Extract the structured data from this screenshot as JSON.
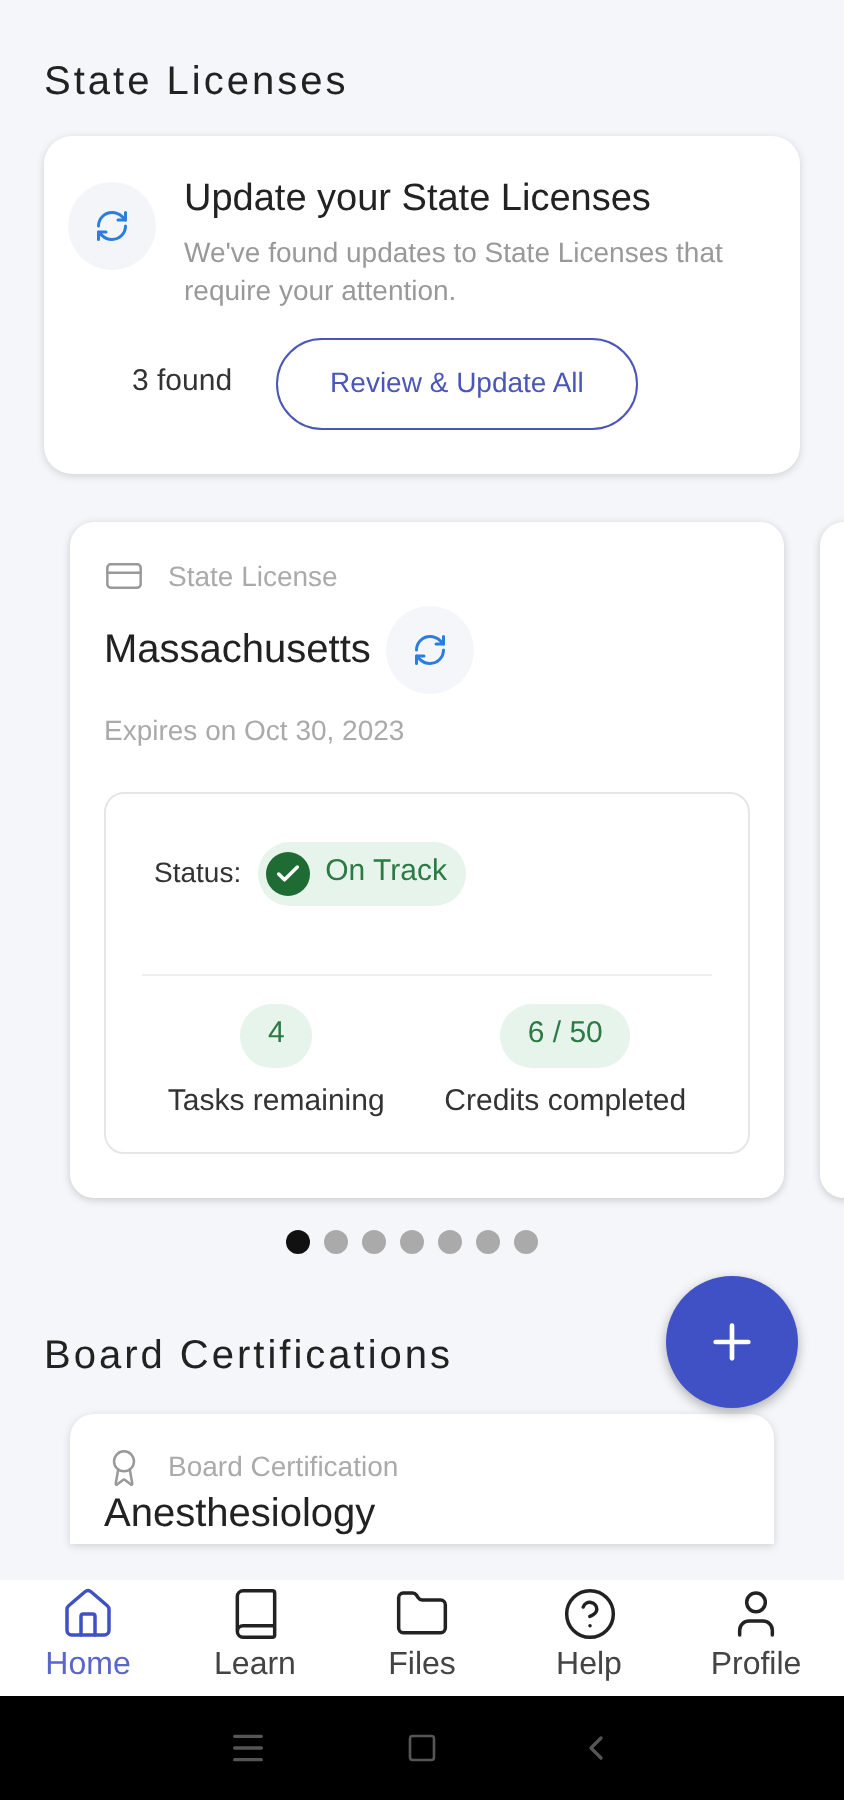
{
  "state_licenses": {
    "title": "State Licenses",
    "update_card": {
      "title": "Update your State Licenses",
      "description": "We've found updates to State Licenses that require your attention.",
      "count": "3 found",
      "button": "Review & Update All"
    },
    "license_card": {
      "type_label": "State License",
      "name": "Massachusetts",
      "expires": "Expires on Oct 30, 2023",
      "status_label": "Status:",
      "status": "On Track",
      "stats": [
        {
          "value": "4",
          "label": "Tasks remaining"
        },
        {
          "value": "6 / 50",
          "label": "Credits completed"
        }
      ]
    },
    "pager": [
      {
        "selected": true
      },
      {
        "selected": false
      },
      {
        "selected": false
      },
      {
        "selected": false
      },
      {
        "selected": false
      },
      {
        "selected": false
      },
      {
        "selected": false
      }
    ]
  },
  "board_certifications": {
    "title": "Board Certifications",
    "card": {
      "type_label": "Board Certification",
      "name": "Anesthesiology"
    }
  },
  "nav": [
    {
      "kind": "home",
      "label": "Home",
      "selected": true
    },
    {
      "kind": "book",
      "label": "Learn",
      "selected": false
    },
    {
      "kind": "folder",
      "label": "Files",
      "selected": false
    },
    {
      "kind": "help",
      "label": "Help",
      "selected": false
    },
    {
      "kind": "user",
      "label": "Profile",
      "selected": false
    }
  ]
}
